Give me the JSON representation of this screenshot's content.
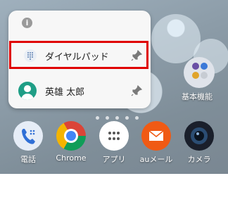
{
  "popup": {
    "info_icon": "info-icon",
    "items": [
      {
        "label": "ダイヤルパッド",
        "icon": "dialpad-icon"
      },
      {
        "label": "英雄 太郎",
        "icon": "contact-avatar-icon"
      }
    ],
    "pin_icon": "pin-icon"
  },
  "home": {
    "widget_label": "基本機能"
  },
  "dock": {
    "apps": [
      {
        "label": "電話",
        "icon": "phone-icon"
      },
      {
        "label": "Chrome",
        "icon": "chrome-icon"
      },
      {
        "label": "アプリ",
        "icon": "app-drawer-icon"
      },
      {
        "label": "auメール",
        "icon": "au-mail-icon"
      },
      {
        "label": "カメラ",
        "icon": "camera-icon"
      }
    ]
  },
  "colors": {
    "highlight": "#e00000",
    "contact_avatar": "#1f9e86",
    "au_orange": "#f05a14"
  }
}
